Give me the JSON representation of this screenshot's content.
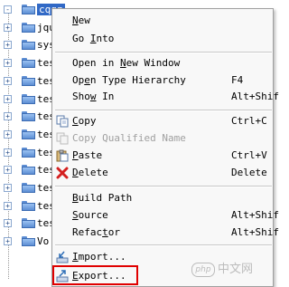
{
  "tree": {
    "items": [
      {
        "label": "cqgz",
        "selected": true,
        "toggle": "-"
      },
      {
        "label": "jqu",
        "selected": false,
        "toggle": "+"
      },
      {
        "label": "sys",
        "selected": false,
        "toggle": "+"
      },
      {
        "label": "tes",
        "selected": false,
        "toggle": "+"
      },
      {
        "label": "tes",
        "selected": false,
        "toggle": "+"
      },
      {
        "label": "tes",
        "selected": false,
        "toggle": "+"
      },
      {
        "label": "tes",
        "selected": false,
        "toggle": "+"
      },
      {
        "label": "tes",
        "selected": false,
        "toggle": "+"
      },
      {
        "label": "tes",
        "selected": false,
        "toggle": "+"
      },
      {
        "label": "tes",
        "selected": false,
        "toggle": "+"
      },
      {
        "label": "tes",
        "selected": false,
        "toggle": "+"
      },
      {
        "label": "tes",
        "selected": false,
        "toggle": "+"
      },
      {
        "label": "tes",
        "selected": false,
        "toggle": "+"
      },
      {
        "label": "Vo",
        "selected": false,
        "toggle": "+"
      }
    ]
  },
  "menu": {
    "new": {
      "label": "New",
      "mnemonic": "N"
    },
    "go_into": {
      "label": "Go Into",
      "mnemonic": "I"
    },
    "open_new_window": {
      "label": "Open in New Window",
      "mnemonic": "N"
    },
    "open_type_hierarchy": {
      "label": "Open Type Hierarchy",
      "accel": "F4",
      "mnemonic": "e"
    },
    "show_in": {
      "label": "Show In",
      "accel": "Alt+Shif",
      "mnemonic": "w"
    },
    "copy": {
      "label": "Copy",
      "accel": "Ctrl+C",
      "mnemonic": "C"
    },
    "copy_qualified": {
      "label": "Copy Qualified Name"
    },
    "paste": {
      "label": "Paste",
      "accel": "Ctrl+V",
      "mnemonic": "P"
    },
    "delete": {
      "label": "Delete",
      "accel": "Delete",
      "mnemonic": "D"
    },
    "build_path": {
      "label": "Build Path",
      "mnemonic": "B"
    },
    "source": {
      "label": "Source",
      "accel": "Alt+Shif",
      "mnemonic": "S"
    },
    "refactor": {
      "label": "Refactor",
      "accel": "Alt+Shif",
      "mnemonic": "t"
    },
    "import": {
      "label": "Import...",
      "mnemonic": "I"
    },
    "export": {
      "label": "Export...",
      "mnemonic": "E"
    }
  },
  "watermark": {
    "logo": "php",
    "text": "中文网"
  },
  "colors": {
    "selection": "#3169c6",
    "highlight": "#e00000",
    "folder": "#5d8ed4"
  }
}
